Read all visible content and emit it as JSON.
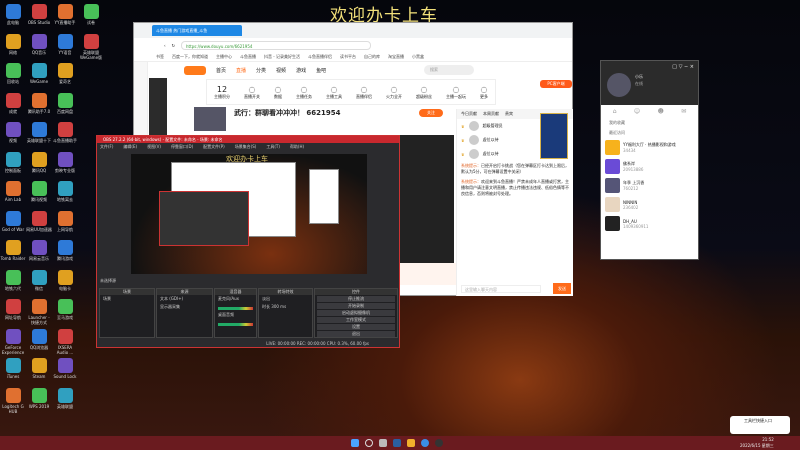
{
  "banner": "欢迎办卡上车",
  "desktop_icons": [
    [
      "此电脑",
      "网络",
      "回收站",
      "成就",
      "视频",
      "控制面板",
      "Aim Lab",
      "God of War",
      "Tomb Raider",
      "地铁六代",
      "网址导航",
      "GeForce Experience",
      "iTunes",
      "Logitech G HUB"
    ],
    [
      "OBS Studio",
      "QQ音乐",
      "WeGame",
      "腾讯助手7.0",
      "英雄联盟十下",
      "腾讯QQ",
      "腾讯视频",
      "网易UU加速器",
      "网易云音乐",
      "微信",
      "Launcher - 快捷方式",
      "QQ浏览器",
      "Steam",
      "WPS 2019"
    ],
    [
      "YY直播助手",
      "YY语音",
      "爱奇艺",
      "百度网盘",
      "斗鱼直播助手",
      "剪映专业版",
      "地铁离去",
      "上网导航",
      "腾讯游戏",
      "电脑卡",
      "至马游戏",
      "IXSERA Audio ...",
      "Sound Lock",
      "英雄联盟"
    ],
    [
      "试卷",
      "英雄联盟 WeGame版"
    ]
  ],
  "browser": {
    "tab": "斗鱼直播 热门游戏直播_斗鱼",
    "url": "https://www.douyu.com/6621954",
    "search_hint": "你要看的直播内容",
    "bookmarks": [
      "书签",
      "百度一下，你就知道",
      "主播中心",
      "斗鱼直播",
      "抖音 - 记录美好生活",
      "斗鱼直播伴侣",
      "读书平台",
      "自己的库",
      "淘宝直播",
      "小黑盒"
    ],
    "nav": [
      "首页",
      "直播",
      "分类",
      "视频",
      "游戏",
      "鱼吧"
    ],
    "search": "搜索",
    "stats": [
      {
        "n": "12",
        "l": "主播积分"
      },
      {
        "n": "",
        "l": "直播开关"
      },
      {
        "n": "",
        "l": "数据"
      },
      {
        "n": "",
        "l": "主播任务"
      },
      {
        "n": "",
        "l": "主播工具"
      },
      {
        "n": "",
        "l": "直播伴侣"
      },
      {
        "n": "",
        "l": "火力全开"
      },
      {
        "n": "",
        "l": "超级粉丝"
      },
      {
        "n": "",
        "l": "主播一起玩"
      },
      {
        "n": "",
        "l": "更多"
      }
    ],
    "room_title": "武行：群聊看冲冲冲！ 6621954",
    "follow": "关注",
    "pc_client": "PC客户端",
    "chat": {
      "tabs": [
        "今日贡献",
        "本周贡献",
        "贵宾"
      ],
      "ranks": [
        "超级管理员",
        "虚位以待",
        "虚位以待"
      ],
      "notice_label": "系统提示：",
      "notice1": "已经开启打卡挑战（您在弹幕区打卡达到上限后，默认为5分，可在弹幕设置中关闭）",
      "notice2": "欢迎来到斗鱼直播！严禁未成年人直播或打赏，主播和用户请注意文明直播，禁止传播违法违规、低俗色情等不良信息，否则将被封号处理。",
      "input": "这里输入聊天内容",
      "send": "发送"
    }
  },
  "obs": {
    "title": "OBS 27.2.2 (64-bit, windows) - 配置文件: 未命名 - 场景: 未命名",
    "menu": [
      "文件(F)",
      "编辑(E)",
      "视图(V)",
      "停靠窗口(D)",
      "配置文件(P)",
      "场景集合(S)",
      "工具(T)",
      "帮助(H)"
    ],
    "preview_banner": "欢迎办卡上车",
    "docks": [
      {
        "title": "场景",
        "items": [
          "场景"
        ]
      },
      {
        "title": "来源",
        "items": [
          "文本 (GDI+)",
          "显示器采集"
        ]
      },
      {
        "title": "混音器",
        "items": [
          "麦克风/Aux",
          "桌面音频"
        ]
      },
      {
        "title": "转场特效",
        "items": [
          "淡出",
          "时长 300 ms"
        ]
      },
      {
        "title": "控件",
        "items": [
          "停止推流",
          "开始录制",
          "启动虚拟摄像机",
          "工作室模式",
          "设置",
          "退出"
        ]
      }
    ],
    "source_bar": "未选择源",
    "status": "LIVE: 00:00:00   REC: 00:00:00   CPU: 0.3%, 60.00 fps"
  },
  "yy": {
    "name": "小乐",
    "status": "在线",
    "sections": [
      "我的收藏",
      "最近访问"
    ],
    "rooms": [
      {
        "name": "YY福利大厅 · 热播影视和游戏",
        "id": "34434",
        "color": "#f7b21c"
      },
      {
        "name": "佛系岸",
        "id": "20913886",
        "color": "#6a4bd6"
      },
      {
        "name": "年季 上沉香",
        "id": "760212",
        "color": "#557"
      },
      {
        "name": "NINNIN",
        "id": "236402",
        "color": "#e8d6c0"
      },
      {
        "name": "DH_AU",
        "id": "1409360911",
        "color": "#222"
      }
    ]
  },
  "taskbar": {
    "time": "21:52",
    "date": "2022/6/15 星期三",
    "notification": "工具栏快捷入口"
  }
}
